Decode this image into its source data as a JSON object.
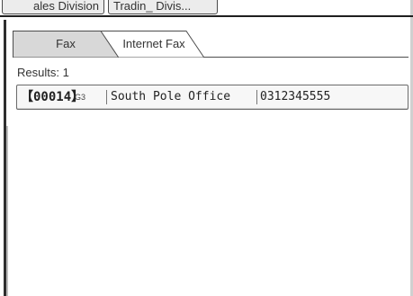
{
  "top_tabs": [
    {
      "label": "ales Division"
    },
    {
      "label": "Tradin_ Divis..."
    }
  ],
  "tabs": [
    {
      "label": "Fax",
      "selected": true
    },
    {
      "label": "Internet Fax",
      "selected": false
    }
  ],
  "results_label": "Results: 1",
  "results": [
    {
      "reg_no": "【00014】",
      "mode": "G3",
      "name": "South Pole Office",
      "number": "0312345555"
    }
  ],
  "colors": {
    "tab_selected": "#d8d8d8",
    "tab_unselected": "#ffffff",
    "border": "#4d4d4d"
  }
}
